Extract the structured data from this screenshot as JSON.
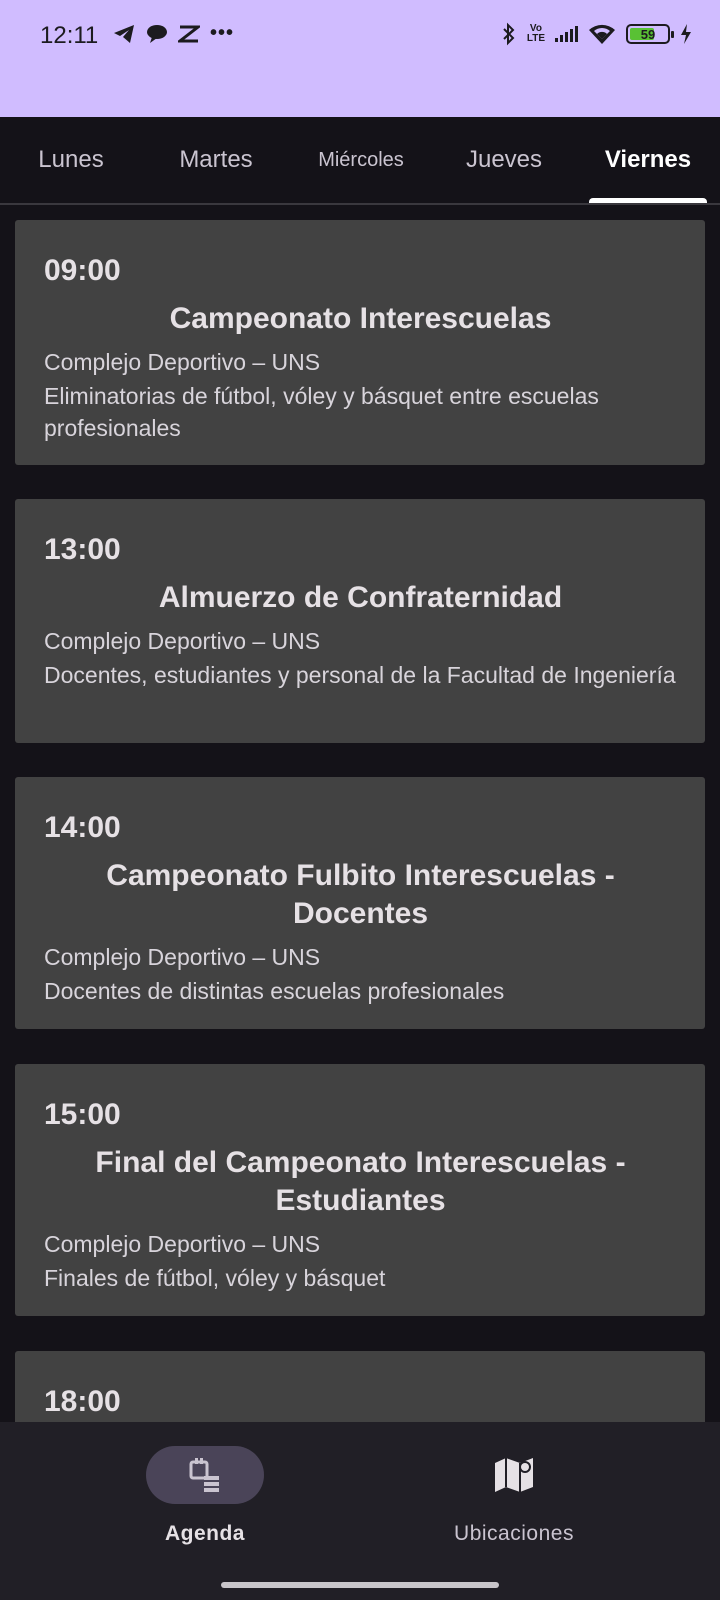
{
  "status_bar": {
    "time": "12:11",
    "left_icons": [
      "telegram-icon",
      "chat-bubble-icon",
      "capcut-icon",
      "more-dots-icon"
    ],
    "volte_label": "Vo LTE",
    "battery_percent": "59",
    "colors": {
      "background": "#d0bcff",
      "battery_fill": "#59c134"
    }
  },
  "tabs": [
    {
      "label": "Lunes",
      "active": false
    },
    {
      "label": "Martes",
      "active": false
    },
    {
      "label": "Miércoles",
      "active": false
    },
    {
      "label": "Jueves",
      "active": false
    },
    {
      "label": "Viernes",
      "active": true
    }
  ],
  "events": [
    {
      "time": "09:00",
      "title": "Campeonato Interescuelas",
      "place": "Complejo Deportivo – UNS",
      "description": "Eliminatorias de fútbol, vóley y básquet entre escuelas profesionales"
    },
    {
      "time": "13:00",
      "title": "Almuerzo de Confraternidad",
      "place": "Complejo Deportivo – UNS",
      "description": "Docentes, estudiantes y personal de la Facultad de Ingeniería"
    },
    {
      "time": "14:00",
      "title": "Campeonato Fulbito Interescuelas - Docentes",
      "place": "Complejo Deportivo – UNS",
      "description": "Docentes de distintas escuelas profesionales"
    },
    {
      "time": "15:00",
      "title": "Final del Campeonato Interescuelas - Estudiantes",
      "place": "Complejo Deportivo – UNS",
      "description": "Finales de fútbol, vóley y básquet"
    },
    {
      "time": "18:00"
    }
  ],
  "bottom_nav": [
    {
      "label": "Agenda",
      "icon": "calendar-icon",
      "active": true
    },
    {
      "label": "Ubicaciones",
      "icon": "map-icon",
      "active": false
    }
  ],
  "colors": {
    "background": "#141218",
    "card": "#424242",
    "nav_background": "#211f26",
    "nav_active_pill": "#4a4458"
  }
}
